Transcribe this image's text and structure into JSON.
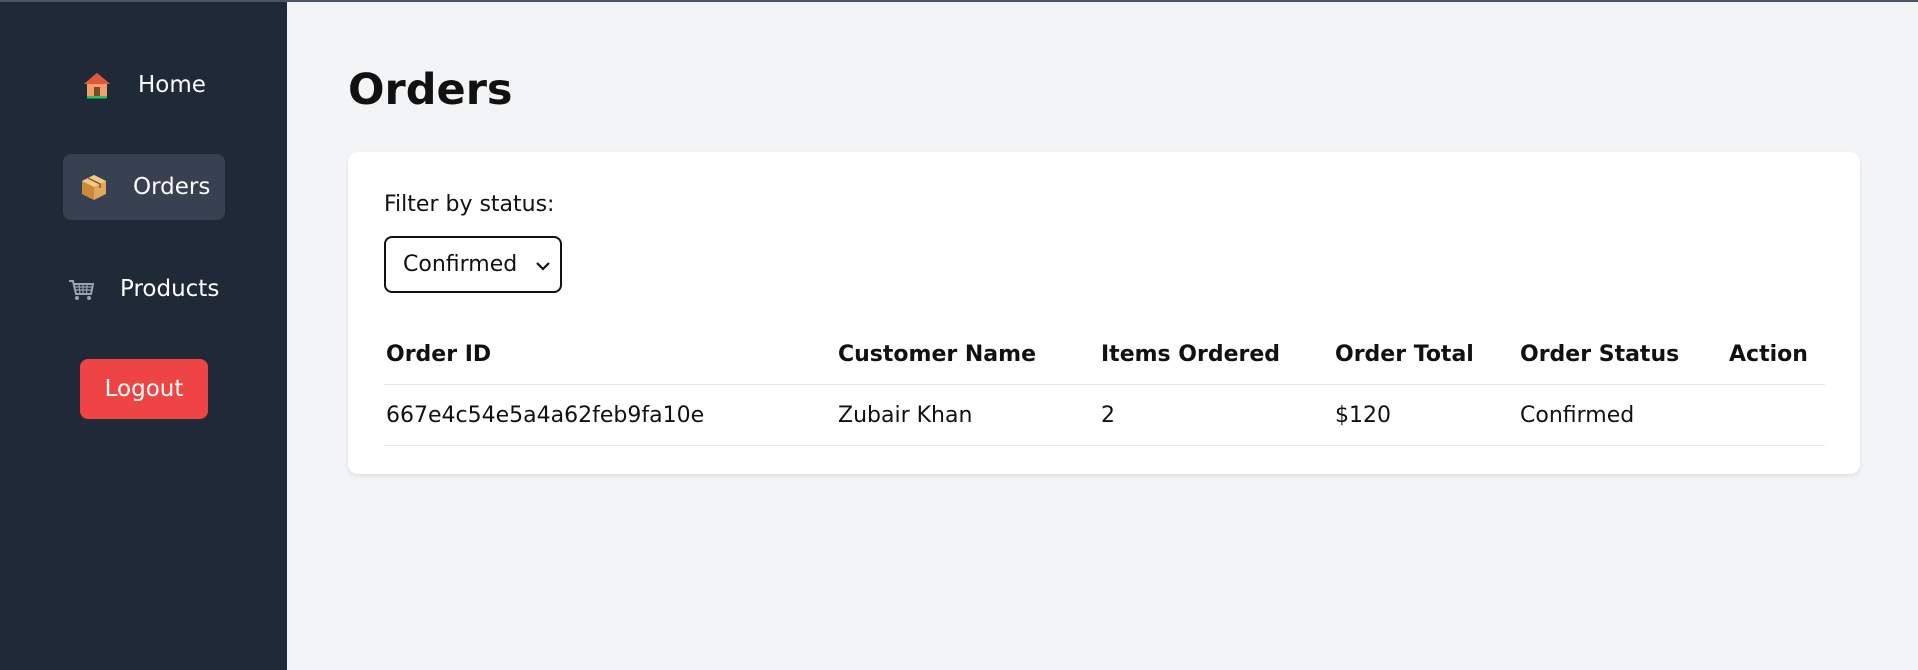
{
  "sidebar": {
    "items": [
      {
        "label": "Home",
        "icon": "house-icon"
      },
      {
        "label": "Orders",
        "icon": "package-icon",
        "active": true
      },
      {
        "label": "Products",
        "icon": "shopping-cart-icon"
      }
    ],
    "logout_label": "Logout"
  },
  "main": {
    "title": "Orders",
    "filter": {
      "label": "Filter by status:",
      "selected": "Confirmed"
    },
    "table": {
      "headers": [
        "Order ID",
        "Customer Name",
        "Items Ordered",
        "Order Total",
        "Order Status",
        "Action"
      ],
      "rows": [
        {
          "order_id": "667e4c54e5a4a62feb9fa10e",
          "customer_name": "Zubair Khan",
          "items_ordered": "2",
          "order_total": "$120",
          "order_status": "Confirmed",
          "action": ""
        }
      ]
    }
  },
  "colors": {
    "sidebar_bg": "#1f2937",
    "active_item_bg": "#374151",
    "logout_bg": "#ef4444",
    "page_bg": "#f3f4f6"
  }
}
